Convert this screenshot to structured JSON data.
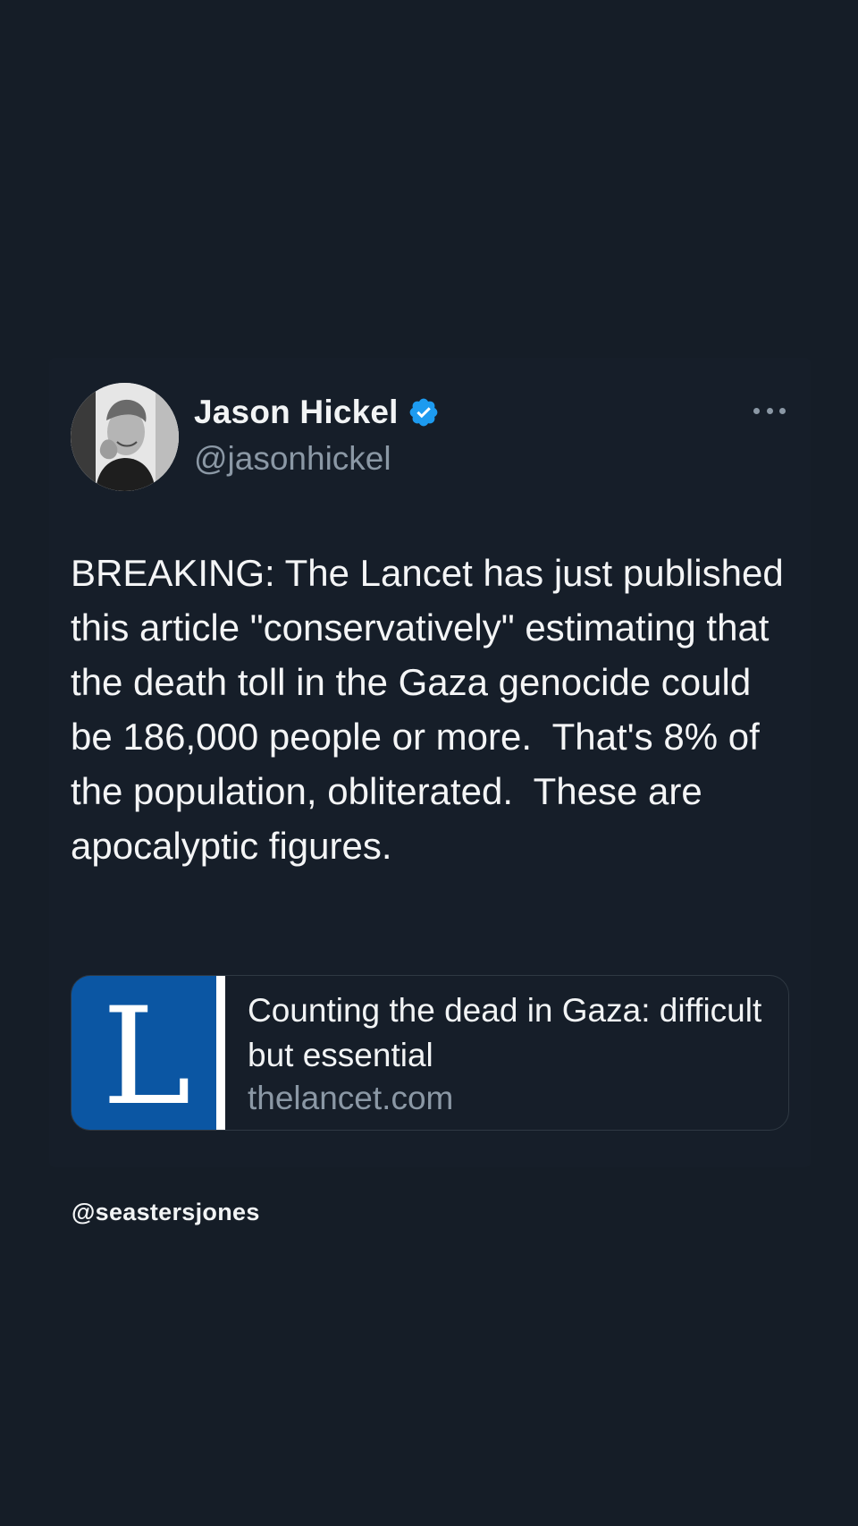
{
  "tweet": {
    "author": {
      "display_name": "Jason Hickel",
      "handle": "@jasonhickel",
      "verified": true,
      "verified_color": "#1d9bf0"
    },
    "text": "BREAKING: The Lancet has just published this article \"conservatively\" estimating that the death toll in the Gaza genocide could be 186,000 people or more.  That's 8% of the population, obliterated.  These are apocalyptic figures.",
    "link_card": {
      "title": "Counting the dead in Gaza: difficult but essential",
      "domain": "thelancet.com",
      "thumbnail_letter": "L",
      "thumbnail_color": "#0b56a3"
    },
    "menu_icon": "more-horizontal-icon"
  },
  "watermark": "@seastersjones",
  "colors": {
    "background": "#151d27",
    "text_primary": "#f2f4f5",
    "text_secondary": "#8b98a5",
    "card_border": "#2f3943"
  }
}
